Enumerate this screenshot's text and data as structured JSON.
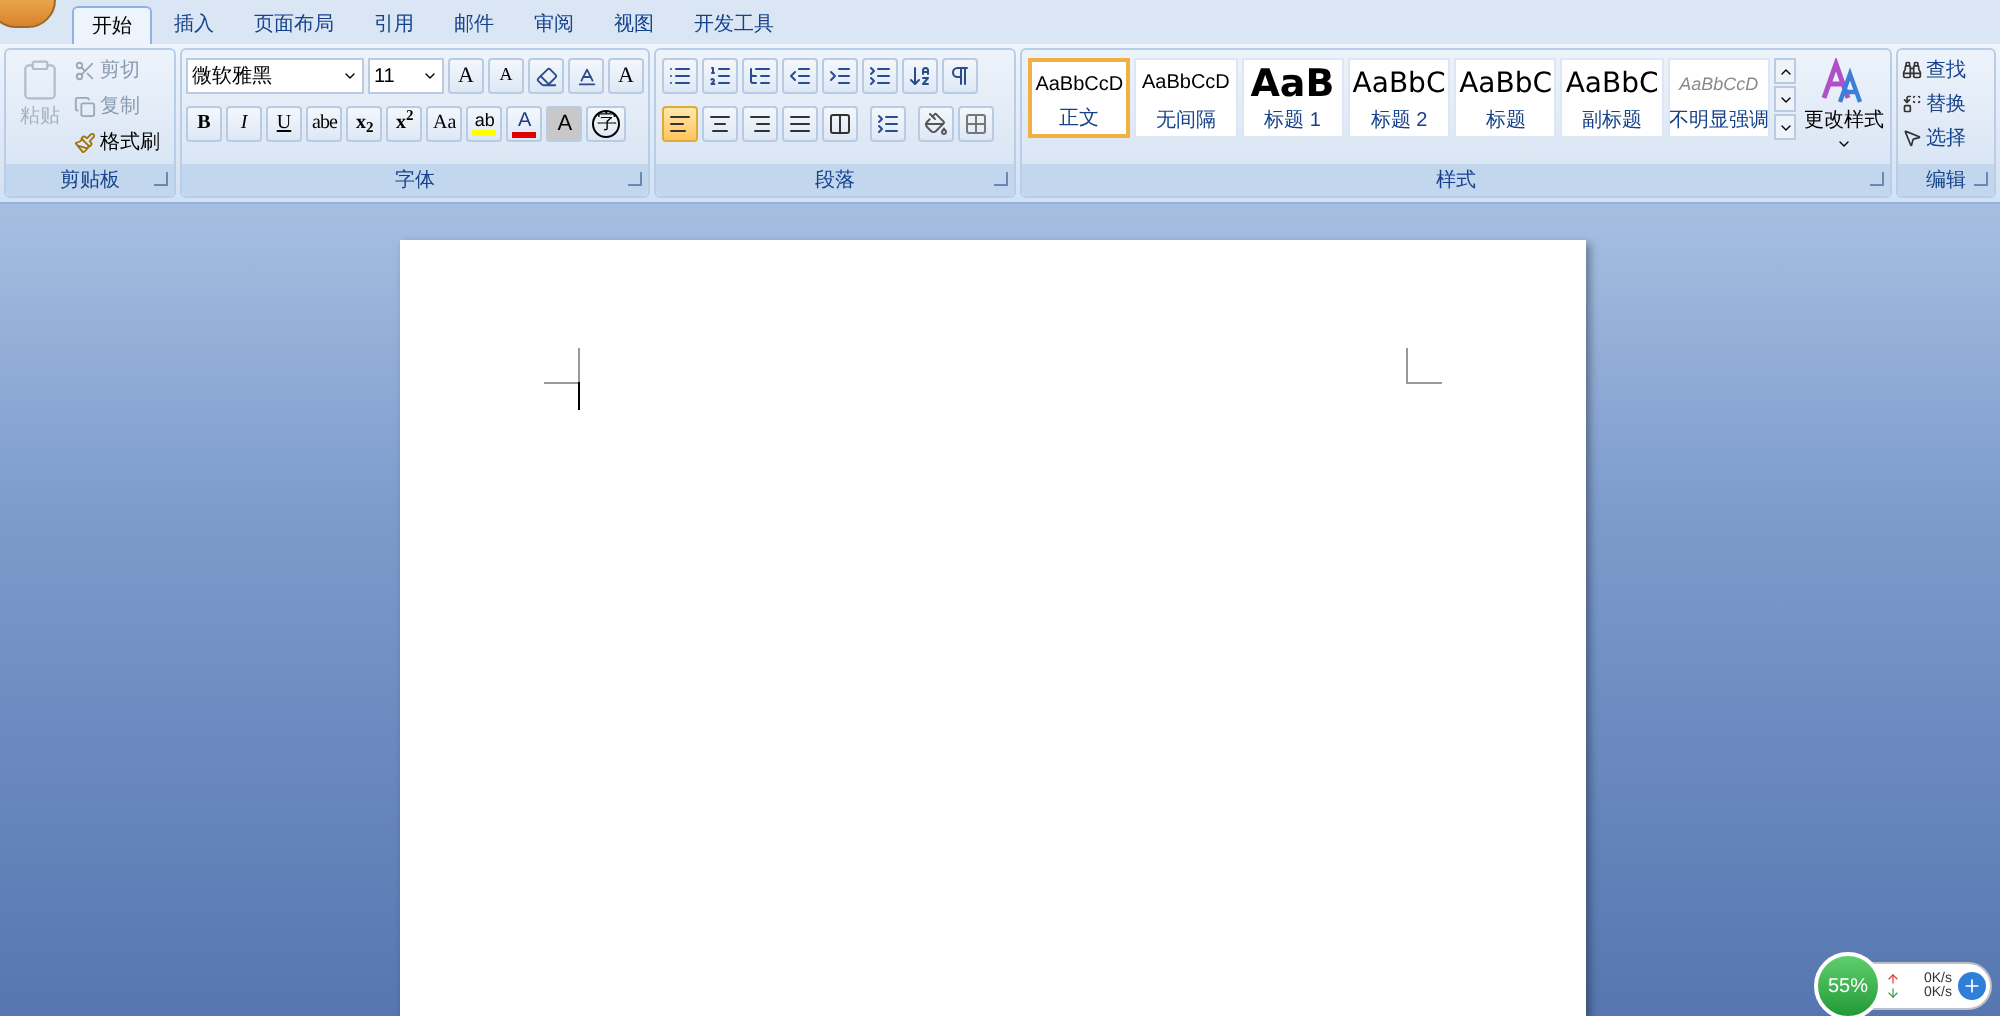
{
  "tabs": [
    {
      "label": "开始",
      "selected": true
    },
    {
      "label": "插入",
      "selected": false
    },
    {
      "label": "页面布局",
      "selected": false
    },
    {
      "label": "引用",
      "selected": false
    },
    {
      "label": "邮件",
      "selected": false
    },
    {
      "label": "审阅",
      "selected": false
    },
    {
      "label": "视图",
      "selected": false
    },
    {
      "label": "开发工具",
      "selected": false
    }
  ],
  "clipboard": {
    "paste": {
      "label": "粘贴",
      "disabled": true
    },
    "items": [
      {
        "label": "剪切",
        "disabled": true
      },
      {
        "label": "复制",
        "disabled": true
      },
      {
        "label": "格式刷",
        "disabled": false
      }
    ],
    "group_label": "剪贴板"
  },
  "font": {
    "family": "微软雅黑",
    "size": "11",
    "row1": [
      "A",
      "A",
      "A"
    ],
    "row2": [
      "B",
      "I",
      "U",
      "abe",
      "x$_{2}$",
      "x$^{2}$",
      "Aa"
    ],
    "highlight": "ab",
    "font_color_button": "A",
    "shading": "A",
    "enclose": "字",
    "group_label": "字体"
  },
  "paragraph": {
    "alignment": [
      {
        "selected": true
      },
      {
        "selected": false
      },
      {
        "selected": false
      },
      {
        "selected": false
      },
      {
        "selected": false
      }
    ],
    "group_label": "段落"
  },
  "styles": {
    "items": [
      {
        "preview": "AaBbCcD",
        "label": "正文",
        "kind": "normal",
        "selected": true
      },
      {
        "preview": "AaBbCcD",
        "label": "无间隔",
        "kind": "normal",
        "selected": false
      },
      {
        "preview": "AaB",
        "label": "标题 1",
        "kind": "heading1",
        "selected": false
      },
      {
        "preview": "AaBbC",
        "label": "标题 2",
        "kind": "heading2",
        "selected": false
      },
      {
        "preview": "AaBbC",
        "label": "标题",
        "kind": "title",
        "selected": false
      },
      {
        "preview": "AaBbC",
        "label": "副标题",
        "kind": "title",
        "selected": false
      },
      {
        "preview": "AaBbCcD",
        "label": "不明显强调",
        "kind": "subtle",
        "selected": false
      }
    ],
    "change": "更改样式",
    "group_label": "样式"
  },
  "editing": {
    "items": [
      "查找",
      "替换",
      "选择"
    ],
    "group_label": "编辑"
  },
  "speed_widget": {
    "percent": "55%",
    "up": "0K/s",
    "down": "0K/s"
  }
}
